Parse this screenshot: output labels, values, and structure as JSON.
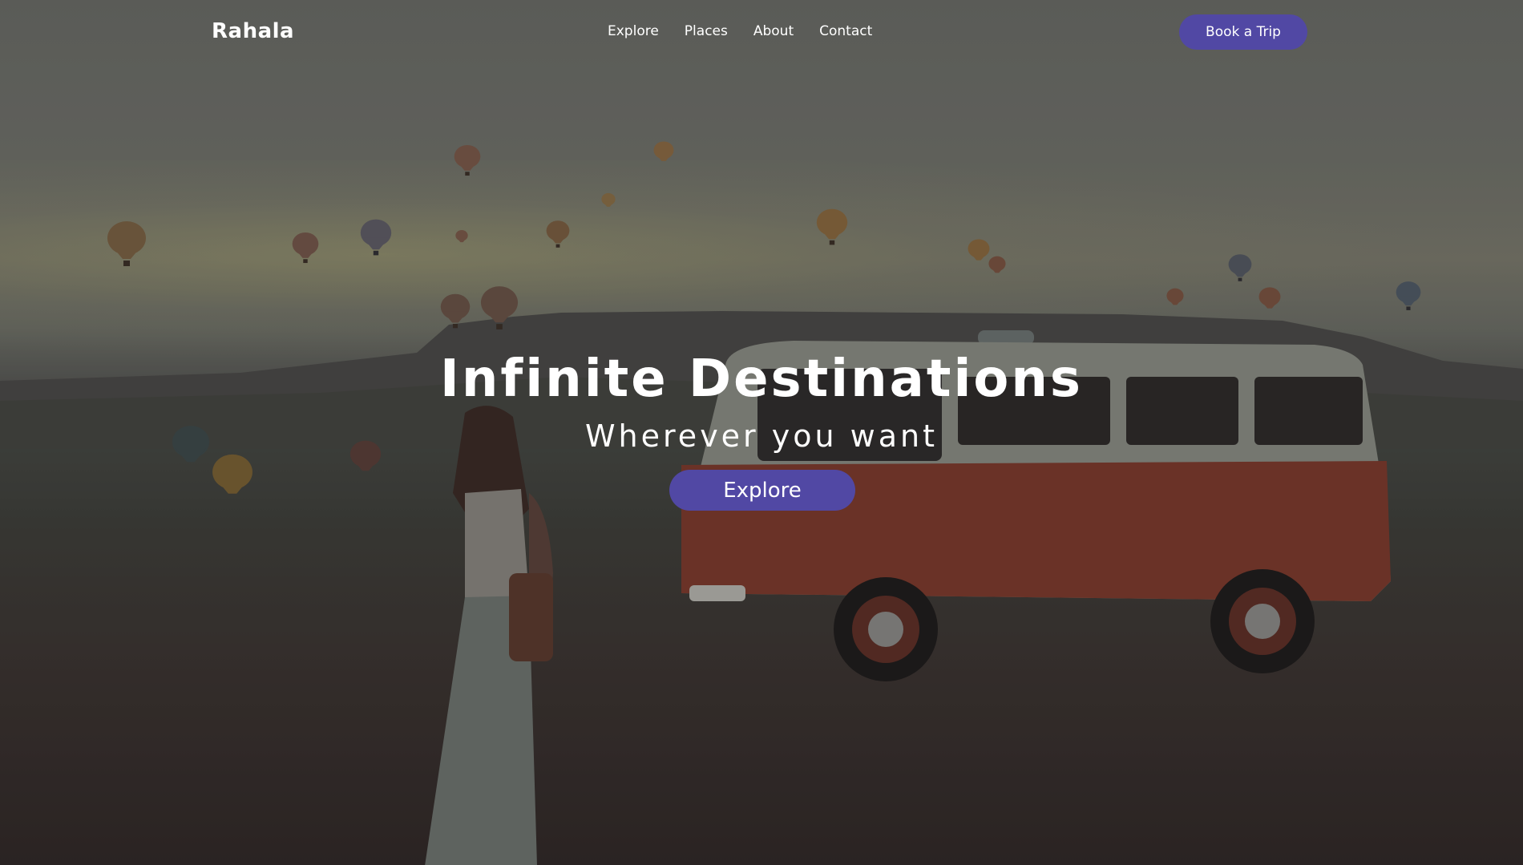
{
  "nav": {
    "brand": "Rahala",
    "links": [
      {
        "label": "Explore"
      },
      {
        "label": "Places"
      },
      {
        "label": "About"
      },
      {
        "label": "Contact"
      }
    ],
    "cta_label": "Book a Trip"
  },
  "hero": {
    "title": "Infinite Destinations",
    "subtitle": "Wherever you want",
    "button_label": "Explore"
  },
  "colors": {
    "accent": "#5148a4",
    "text": "#ffffff"
  }
}
